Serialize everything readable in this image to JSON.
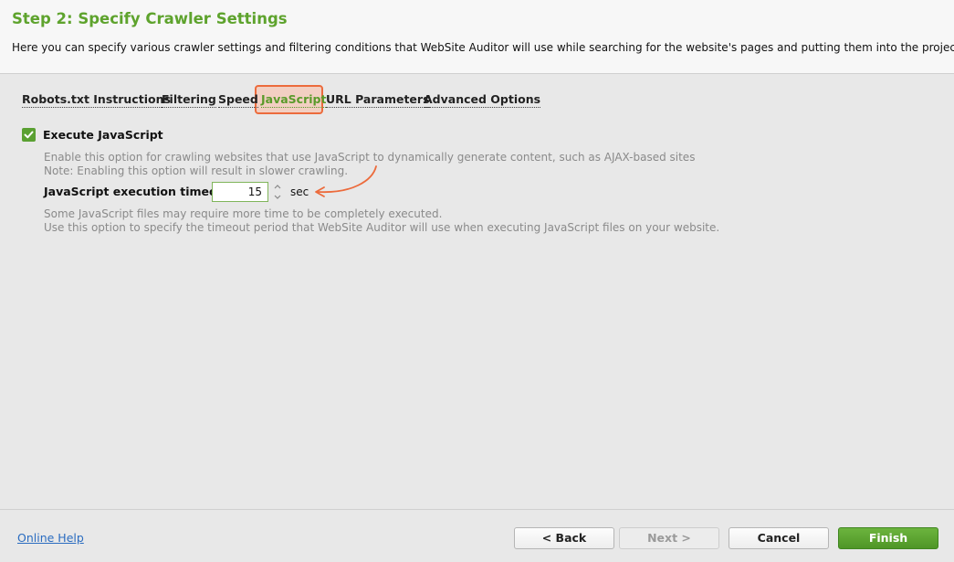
{
  "header": {
    "title": "Step 2: Specify Crawler Settings",
    "subtitle": "Here you can specify various crawler settings and filtering conditions that WebSite Auditor will use while searching for the website's pages and putting them into the project."
  },
  "tabs": [
    {
      "label": "Robots.txt Instructions",
      "active": false
    },
    {
      "label": "Filtering",
      "active": false
    },
    {
      "label": "Speed",
      "active": false
    },
    {
      "label": "JavaScript",
      "active": true
    },
    {
      "label": "URL Parameters",
      "active": false
    },
    {
      "label": "Advanced Options",
      "active": false
    }
  ],
  "javascript": {
    "execute_label": "Execute JavaScript",
    "execute_checked": true,
    "desc_line1": "Enable this option for crawling websites that use JavaScript to dynamically generate content, such as AJAX-based sites",
    "desc_line2": "Note: Enabling this option will result in slower crawling.",
    "timeout_label": "JavaScript execution timeout",
    "timeout_value": "15",
    "timeout_unit": "sec",
    "timeout_desc_line1": "Some JavaScript files may require more time to be completely executed.",
    "timeout_desc_line2": "Use this option to specify the timeout period that WebSite Auditor will use when executing JavaScript files on your website."
  },
  "footer": {
    "help_label": "Online Help",
    "back_label": "< Back",
    "next_label": "Next >",
    "cancel_label": "Cancel",
    "finish_label": "Finish"
  },
  "colors": {
    "accent": "#5ea32d",
    "highlight": "#ec6b3c"
  }
}
